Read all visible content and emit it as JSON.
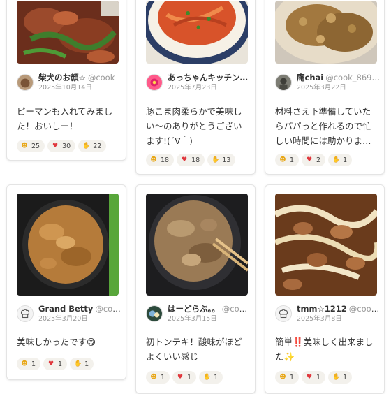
{
  "cards": [
    {
      "author_name": "柴犬のお顔☆",
      "author_handle": "@cook",
      "date": "2025年10月14日",
      "comment": "ピーマンも入れてみました！おいしー！",
      "reactions": {
        "smile": "25",
        "heart": "30",
        "clap": "22"
      }
    },
    {
      "author_name": "あっちゃんキッチン…",
      "author_handle": "",
      "date": "2025年7月23日",
      "comment": "豚こま肉柔らかで美味しい〜のありがとうございます!(´∇｀)",
      "reactions": {
        "smile": "18",
        "heart": "18",
        "clap": "13"
      }
    },
    {
      "author_name": "庵chai",
      "author_handle": "@cook_8695…",
      "date": "2025年3月22日",
      "comment": "材料さえ下準備していたらパパっと作れるので忙しい時間には助かりま…",
      "reactions": {
        "smile": "1",
        "heart": "2",
        "clap": "1"
      }
    },
    {
      "author_name": "Grand Betty",
      "author_handle": "@cook…",
      "date": "2025年3月20日",
      "comment": "美味しかったです😋",
      "reactions": {
        "smile": "1",
        "heart": "1",
        "clap": "1"
      }
    },
    {
      "author_name": "はーどらぶ。。",
      "author_handle": "@coo…",
      "date": "2025年3月15日",
      "comment": "初トンテキ！酸味がほどよくいい感じ",
      "reactions": {
        "smile": "1",
        "heart": "1",
        "clap": "1"
      }
    },
    {
      "author_name": "tmm☆1212",
      "author_handle": "@cook…",
      "date": "2025年3月8日",
      "comment": "簡単‼️美味しく出来ました✨",
      "reactions": {
        "smile": "1",
        "heart": "1",
        "clap": "1"
      }
    }
  ],
  "icons": {
    "smile": "smile-emoji-icon",
    "heart": "heart-icon",
    "clap": "clap-icon"
  },
  "colors": {
    "heart": "#e0383e",
    "chip_bg": "#f3f1ec",
    "date": "#9a9a9a"
  }
}
